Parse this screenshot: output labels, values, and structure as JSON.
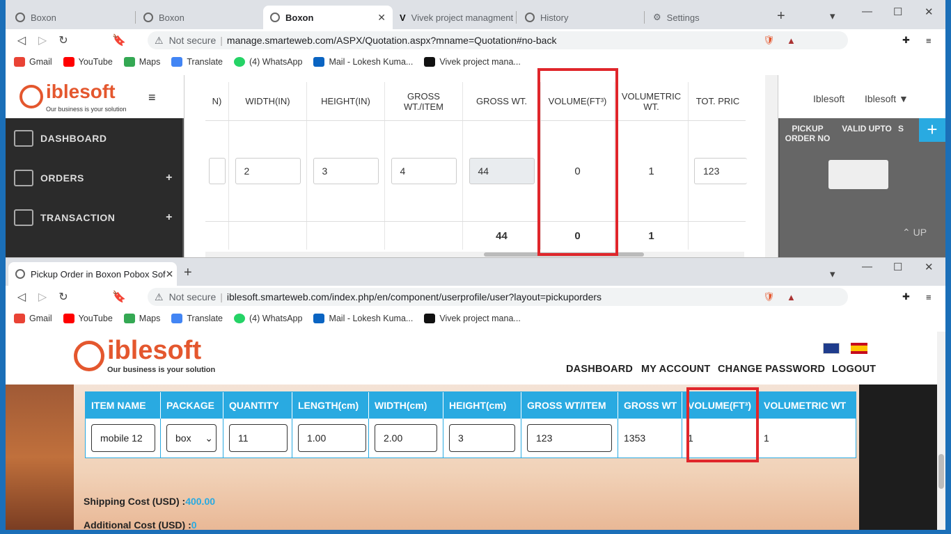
{
  "window1": {
    "tabs": [
      {
        "title": "Boxon",
        "active": false
      },
      {
        "title": "Boxon",
        "active": false
      },
      {
        "title": "Boxon",
        "active": true
      },
      {
        "title": "Vivek project managment",
        "active": false
      },
      {
        "title": "History",
        "active": false
      },
      {
        "title": "Settings",
        "active": false
      }
    ],
    "security": "Not secure",
    "url": "manage.smarteweb.com/ASPX/Quotation.aspx?mname=Quotation#no-back",
    "bookmarks": [
      "Gmail",
      "YouTube",
      "Maps",
      "Translate",
      "(4) WhatsApp",
      "Mail - Lokesh Kuma...",
      "Vivek project mana..."
    ],
    "logo_text": "iblesoft",
    "logo_tagline": "Our business is your solution",
    "user_name": "Iblesoft",
    "user_menu": "Iblesoft",
    "sidebar": [
      {
        "label": "DASHBOARD",
        "plus": ""
      },
      {
        "label": "ORDERS",
        "plus": "+"
      },
      {
        "label": "TRANSACTION",
        "plus": "+"
      }
    ],
    "table": {
      "headers": [
        "N)",
        "WIDTH(IN)",
        "HEIGHT(IN)",
        "GROSS WT./ITEM",
        "GROSS WT.",
        "VOLUME(FT³)",
        "VOLUMETRIC WT.",
        "TOT. PRIC"
      ],
      "row": {
        "width": "2",
        "height": "3",
        "gross_item": "4",
        "gross_wt": "44",
        "volume": "0",
        "volumetric": "1",
        "price": "123"
      },
      "totals": {
        "gross_wt": "44",
        "volume": "0",
        "volumetric": "1"
      }
    },
    "right_panel": {
      "col1": "PICKUP\nORDER NO",
      "col2": "VALID UPTO",
      "col3": "S",
      "up": "UP"
    }
  },
  "window2": {
    "tab_title": "Pickup Order in Boxon Pobox Sof",
    "security": "Not secure",
    "url": "iblesoft.smarteweb.com/index.php/en/component/userprofile/user?layout=pickuporders",
    "bookmarks": [
      "Gmail",
      "YouTube",
      "Maps",
      "Translate",
      "(4) WhatsApp",
      "Mail - Lokesh Kuma...",
      "Vivek project mana..."
    ],
    "logo_text": "iblesoft",
    "logo_tagline": "Our business is your solution",
    "nav": [
      "DASHBOARD",
      "MY ACCOUNT",
      "CHANGE PASSWORD",
      "LOGOUT"
    ],
    "table": {
      "headers": [
        "ITEM NAME",
        "PACKAGE",
        "QUANTITY",
        "LENGTH(cm)",
        "WIDTH(cm)",
        "HEIGHT(cm)",
        "GROSS WT/ITEM",
        "GROSS WT",
        "VOLUME(FT³)",
        "VOLUMETRIC WT"
      ],
      "row": {
        "item": "mobile 12",
        "package": "box",
        "quantity": "11",
        "length": "1.00",
        "width": "2.00",
        "height": "3",
        "gross_item": "123",
        "gross_wt": "1353",
        "volume": "1",
        "volumetric": "1"
      }
    },
    "shipping_label": "Shipping Cost (USD) :",
    "shipping_value": "400.00",
    "additional_label": "Additional Cost (USD) :",
    "additional_value": "0"
  },
  "colors": {
    "accent": "#29aae1",
    "highlight": "#e0262b",
    "brand_orange": "#e4572e"
  }
}
